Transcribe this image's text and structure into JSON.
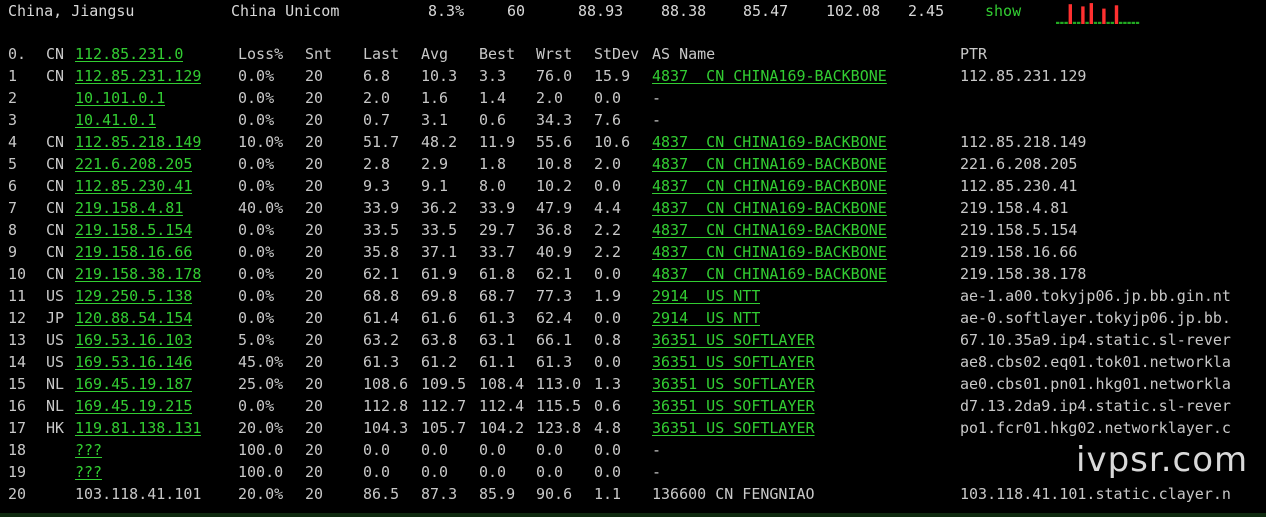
{
  "summary": {
    "location": "China, Jiangsu",
    "isp": "China Unicom",
    "loss": "8.3%",
    "sent": "60",
    "last": "88.93",
    "avg": "88.38",
    "best": "85.47",
    "worst": "102.08",
    "stdev": "2.45",
    "show_label": "show"
  },
  "sparkline": {
    "color": "#ff3030",
    "base_color": "#22aa22",
    "levels": [
      0.1,
      0.1,
      0.1,
      0.9,
      0.1,
      0.1,
      0.8,
      0.1,
      0.95,
      0.1,
      0.1,
      0.7,
      0.1,
      0.1,
      0.85,
      0.1,
      0.1,
      0.1,
      0.1,
      0.1
    ]
  },
  "headers": {
    "hop": "0.",
    "cc": "CN",
    "host": "112.85.231.0",
    "loss": "Loss%",
    "snt": "Snt",
    "last": "Last",
    "avg": "Avg",
    "best": "Best",
    "wrst": "Wrst",
    "stdev": "StDev",
    "asname": "AS Name",
    "ptr": "PTR"
  },
  "rows": [
    {
      "hop": "1",
      "cc": "CN",
      "host": "112.85.231.129",
      "loss": "0.0%",
      "snt": "20",
      "last": "6.8",
      "avg": "10.3",
      "best": "3.3",
      "wrst": "76.0",
      "stdev": "15.9",
      "as": "4837  CN CHINA169-BACKBONE",
      "ptr": "112.85.231.129"
    },
    {
      "hop": "2",
      "cc": "",
      "host": "10.101.0.1",
      "loss": "0.0%",
      "snt": "20",
      "last": "2.0",
      "avg": "1.6",
      "best": "1.4",
      "wrst": "2.0",
      "stdev": "0.0",
      "as": "-",
      "ptr": ""
    },
    {
      "hop": "3",
      "cc": "",
      "host": "10.41.0.1",
      "loss": "0.0%",
      "snt": "20",
      "last": "0.7",
      "avg": "3.1",
      "best": "0.6",
      "wrst": "34.3",
      "stdev": "7.6",
      "as": "-",
      "ptr": ""
    },
    {
      "hop": "4",
      "cc": "CN",
      "host": "112.85.218.149",
      "loss": "10.0%",
      "snt": "20",
      "last": "51.7",
      "avg": "48.2",
      "best": "11.9",
      "wrst": "55.6",
      "stdev": "10.6",
      "as": "4837  CN CHINA169-BACKBONE",
      "ptr": "112.85.218.149"
    },
    {
      "hop": "5",
      "cc": "CN",
      "host": "221.6.208.205",
      "loss": "0.0%",
      "snt": "20",
      "last": "2.8",
      "avg": "2.9",
      "best": "1.8",
      "wrst": "10.8",
      "stdev": "2.0",
      "as": "4837  CN CHINA169-BACKBONE",
      "ptr": "221.6.208.205"
    },
    {
      "hop": "6",
      "cc": "CN",
      "host": "112.85.230.41",
      "loss": "0.0%",
      "snt": "20",
      "last": "9.3",
      "avg": "9.1",
      "best": "8.0",
      "wrst": "10.2",
      "stdev": "0.0",
      "as": "4837  CN CHINA169-BACKBONE",
      "ptr": "112.85.230.41"
    },
    {
      "hop": "7",
      "cc": "CN",
      "host": "219.158.4.81",
      "loss": "40.0%",
      "snt": "20",
      "last": "33.9",
      "avg": "36.2",
      "best": "33.9",
      "wrst": "47.9",
      "stdev": "4.4",
      "as": "4837  CN CHINA169-BACKBONE",
      "ptr": "219.158.4.81"
    },
    {
      "hop": "8",
      "cc": "CN",
      "host": "219.158.5.154",
      "loss": "0.0%",
      "snt": "20",
      "last": "33.5",
      "avg": "33.5",
      "best": "29.7",
      "wrst": "36.8",
      "stdev": "2.2",
      "as": "4837  CN CHINA169-BACKBONE",
      "ptr": "219.158.5.154"
    },
    {
      "hop": "9",
      "cc": "CN",
      "host": "219.158.16.66",
      "loss": "0.0%",
      "snt": "20",
      "last": "35.8",
      "avg": "37.1",
      "best": "33.7",
      "wrst": "40.9",
      "stdev": "2.2",
      "as": "4837  CN CHINA169-BACKBONE",
      "ptr": "219.158.16.66"
    },
    {
      "hop": "10",
      "cc": "CN",
      "host": "219.158.38.178",
      "loss": "0.0%",
      "snt": "20",
      "last": "62.1",
      "avg": "61.9",
      "best": "61.8",
      "wrst": "62.1",
      "stdev": "0.0",
      "as": "4837  CN CHINA169-BACKBONE",
      "ptr": "219.158.38.178"
    },
    {
      "hop": "11",
      "cc": "US",
      "host": "129.250.5.138",
      "loss": "0.0%",
      "snt": "20",
      "last": "68.8",
      "avg": "69.8",
      "best": "68.7",
      "wrst": "77.3",
      "stdev": "1.9",
      "as": "2914  US NTT",
      "ptr": "ae-1.a00.tokyjp06.jp.bb.gin.nt"
    },
    {
      "hop": "12",
      "cc": "JP",
      "host": "120.88.54.154",
      "loss": "0.0%",
      "snt": "20",
      "last": "61.4",
      "avg": "61.6",
      "best": "61.3",
      "wrst": "62.4",
      "stdev": "0.0",
      "as": "2914  US NTT",
      "ptr": "ae-0.softlayer.tokyjp06.jp.bb."
    },
    {
      "hop": "13",
      "cc": "US",
      "host": "169.53.16.103",
      "loss": "5.0%",
      "snt": "20",
      "last": "63.2",
      "avg": "63.8",
      "best": "63.1",
      "wrst": "66.1",
      "stdev": "0.8",
      "as": "36351 US SOFTLAYER",
      "ptr": "67.10.35a9.ip4.static.sl-rever"
    },
    {
      "hop": "14",
      "cc": "US",
      "host": "169.53.16.146",
      "loss": "45.0%",
      "snt": "20",
      "last": "61.3",
      "avg": "61.2",
      "best": "61.1",
      "wrst": "61.3",
      "stdev": "0.0",
      "as": "36351 US SOFTLAYER",
      "ptr": "ae8.cbs02.eq01.tok01.networkla"
    },
    {
      "hop": "15",
      "cc": "NL",
      "host": "169.45.19.187",
      "loss": "25.0%",
      "snt": "20",
      "last": "108.6",
      "avg": "109.5",
      "best": "108.4",
      "wrst": "113.0",
      "stdev": "1.3",
      "as": "36351 US SOFTLAYER",
      "ptr": "ae0.cbs01.pn01.hkg01.networkla"
    },
    {
      "hop": "16",
      "cc": "NL",
      "host": "169.45.19.215",
      "loss": "0.0%",
      "snt": "20",
      "last": "112.8",
      "avg": "112.7",
      "best": "112.4",
      "wrst": "115.5",
      "stdev": "0.6",
      "as": "36351 US SOFTLAYER",
      "ptr": "d7.13.2da9.ip4.static.sl-rever"
    },
    {
      "hop": "17",
      "cc": "HK",
      "host": "119.81.138.131",
      "loss": "20.0%",
      "snt": "20",
      "last": "104.3",
      "avg": "105.7",
      "best": "104.2",
      "wrst": "123.8",
      "stdev": "4.8",
      "as": "36351 US SOFTLAYER",
      "ptr": "po1.fcr01.hkg02.networklayer.c"
    },
    {
      "hop": "18",
      "cc": "",
      "host": "???",
      "loss": "100.0",
      "snt": "20",
      "last": "0.0",
      "avg": "0.0",
      "best": "0.0",
      "wrst": "0.0",
      "stdev": "0.0",
      "as": "-",
      "ptr": ""
    },
    {
      "hop": "19",
      "cc": "",
      "host": "???",
      "loss": "100.0",
      "snt": "20",
      "last": "0.0",
      "avg": "0.0",
      "best": "0.0",
      "wrst": "0.0",
      "stdev": "0.0",
      "as": "-",
      "ptr": ""
    },
    {
      "hop": "20",
      "cc": "",
      "host": "103.118.41.101",
      "loss": "20.0%",
      "snt": "20",
      "last": "86.5",
      "avg": "87.3",
      "best": "85.9",
      "wrst": "90.6",
      "stdev": "1.1",
      "as": "136600 CN FENGNIAO",
      "ptr": "103.118.41.101.static.clayer.n"
    }
  ],
  "watermark": "ivpsr.com",
  "colors": {
    "background": "#000000",
    "accent": "#32cd32",
    "text": "#c8c8c8"
  }
}
